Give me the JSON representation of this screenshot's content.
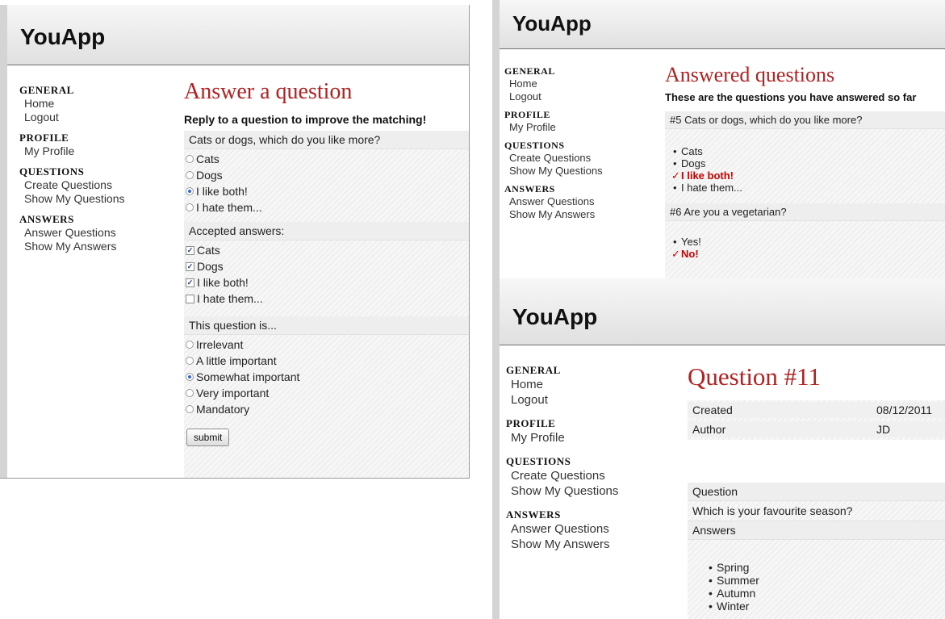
{
  "app": {
    "brand": "YouApp"
  },
  "sidebar": {
    "general": {
      "title": "General",
      "items": [
        "Home",
        "Logout"
      ]
    },
    "profile": {
      "title": "Profile",
      "items": [
        "My Profile"
      ]
    },
    "questions": {
      "title": "Questions",
      "items": [
        "Create Questions",
        "Show My Questions"
      ]
    },
    "answers": {
      "title": "Answers",
      "items": [
        "Answer Questions",
        "Show My Answers"
      ]
    }
  },
  "answer_page": {
    "title": "Answer a question",
    "subtitle": "Reply to a question to improve the matching!",
    "question": "Cats or dogs, which do you like more?",
    "options": [
      {
        "label": "Cats",
        "selected": false
      },
      {
        "label": "Dogs",
        "selected": false
      },
      {
        "label": "I like both!",
        "selected": true
      },
      {
        "label": "I hate them...",
        "selected": false
      }
    ],
    "accepted_label": "Accepted answers:",
    "accepted": [
      {
        "label": "Cats",
        "checked": true
      },
      {
        "label": "Dogs",
        "checked": true
      },
      {
        "label": "I like both!",
        "checked": true
      },
      {
        "label": "I hate them...",
        "checked": false
      }
    ],
    "importance_label": "This question is...",
    "importance": [
      {
        "label": "Irrelevant",
        "selected": false
      },
      {
        "label": "A little important",
        "selected": false
      },
      {
        "label": "Somewhat important",
        "selected": true
      },
      {
        "label": "Very important",
        "selected": false
      },
      {
        "label": "Mandatory",
        "selected": false
      }
    ],
    "submit_label": "submit"
  },
  "answered_page": {
    "title": "Answered questions",
    "subtitle": "These are the questions you have answered so far",
    "questions": [
      {
        "heading": "#5  Cats or dogs, which do you like more?",
        "answers": [
          {
            "label": "Cats",
            "mine": false
          },
          {
            "label": "Dogs",
            "mine": false
          },
          {
            "label": "I like both!",
            "mine": true
          },
          {
            "label": "I hate them...",
            "mine": false
          }
        ]
      },
      {
        "heading": "#6  Are you a vegetarian?",
        "answers": [
          {
            "label": "Yes!",
            "mine": false
          },
          {
            "label": "No!",
            "mine": true
          }
        ]
      }
    ]
  },
  "question_page": {
    "title": "Question #11",
    "created_label": "Created",
    "created_value": "08/12/2011",
    "author_label": "Author",
    "author_value": "JD",
    "question_label": "Question",
    "question_text": "Which is your favourite season?",
    "answers_label": "Answers",
    "answers": [
      "Spring",
      "Summer",
      "Autumn",
      "Winter"
    ]
  }
}
